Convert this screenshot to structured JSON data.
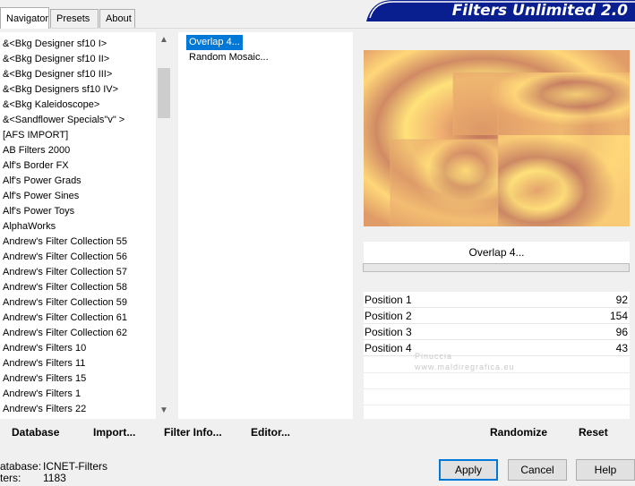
{
  "tabs": [
    {
      "label": "Navigator"
    },
    {
      "label": "Presets"
    },
    {
      "label": "About"
    }
  ],
  "banner": {
    "title": "Filters Unlimited 2.0"
  },
  "categories": [
    "&<Bkg Designer sf10 I>",
    "&<Bkg Designer sf10 II>",
    "&<Bkg Designer sf10 III>",
    "&<Bkg Designers sf10 IV>",
    "&<Bkg Kaleidoscope>",
    "&<Sandflower Specials\"v\" >",
    "[AFS IMPORT]",
    "AB Filters 2000",
    "Alf's Border FX",
    "Alf's Power Grads",
    "Alf's Power Sines",
    "Alf's Power Toys",
    "AlphaWorks",
    "Andrew's Filter Collection 55",
    "Andrew's Filter Collection 56",
    "Andrew's Filter Collection 57",
    "Andrew's Filter Collection 58",
    "Andrew's Filter Collection 59",
    "Andrew's Filter Collection 61",
    "Andrew's Filter Collection 62",
    "Andrew's Filters 10",
    "Andrew's Filters 11",
    "Andrew's Filters 15",
    "Andrew's Filters 1",
    "Andrew's Filters 22"
  ],
  "filters": [
    {
      "label": "Overlap 4...",
      "selected": true
    },
    {
      "label": "Random Mosaic...",
      "selected": false
    }
  ],
  "bottom_links": {
    "database": "Database",
    "import": "Import...",
    "filter_info": "Filter Info...",
    "editor": "Editor..."
  },
  "current_filter": "Overlap 4...",
  "params": [
    {
      "name": "Position 1",
      "value": "92"
    },
    {
      "name": "Position 2",
      "value": "154"
    },
    {
      "name": "Position 3",
      "value": "96"
    },
    {
      "name": "Position 4",
      "value": "43"
    }
  ],
  "watermark": {
    "line1": "Pinuccia",
    "line2": "www.maldiregrafica.eu"
  },
  "actions": {
    "randomize": "Randomize",
    "reset": "Reset"
  },
  "database_info": {
    "label1": "atabase:",
    "value1": "ICNET-Filters",
    "label2": "ters:",
    "value2": "1183"
  },
  "dialog_buttons": {
    "apply": "Apply",
    "cancel": "Cancel",
    "help": "Help"
  },
  "colors": {
    "selection": "#0078d7",
    "banner_bg": "#0a1f8f",
    "preview_light": "#ffe27a",
    "preview_dark": "#b96a58"
  }
}
